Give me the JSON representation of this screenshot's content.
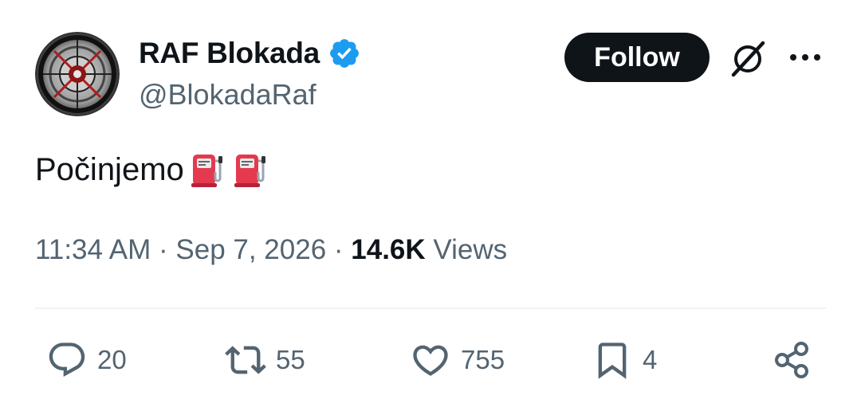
{
  "author": {
    "display_name": "RAF Blokada",
    "handle": "@BlokadaRaf",
    "verified": true
  },
  "header": {
    "follow_label": "Follow",
    "grok_icon": "grok-icon",
    "more_icon": "more-options-icon"
  },
  "tweet": {
    "text": "Počinjemo",
    "emojis": [
      "fuel-pump-emoji",
      "fuel-pump-emoji"
    ]
  },
  "meta": {
    "time": "11:34 AM",
    "separator_1": " · ",
    "date": "Sep 7, 2026",
    "separator_2": " · ",
    "views_count": "14.6K",
    "views_label": " Views"
  },
  "actions": {
    "reply_count": "20",
    "retweet_count": "55",
    "like_count": "755",
    "bookmark_count": "4"
  },
  "colors": {
    "text_primary": "#0f1419",
    "text_secondary": "#536471",
    "verified_blue": "#1d9bf0",
    "divider": "#eff3f4"
  }
}
